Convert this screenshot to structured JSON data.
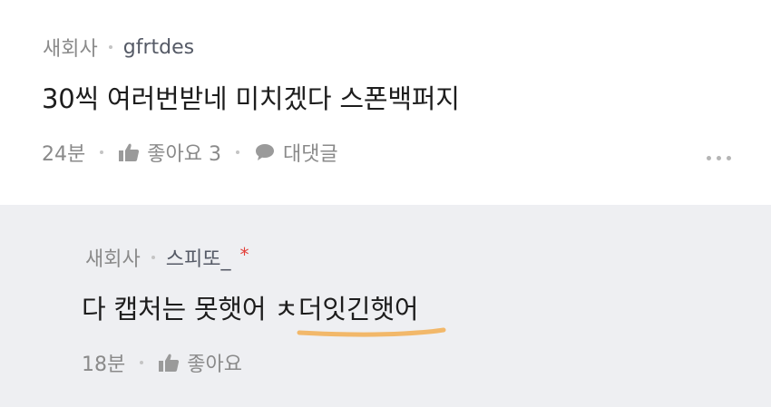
{
  "comment": {
    "company": "새회사",
    "nickname": "gfrtdes",
    "text": "30씩 여러번받네 미치겠다 스폰백퍼지",
    "time": "24분",
    "like_label": "좋아요 3",
    "reply_label": "대댓글"
  },
  "reply": {
    "company": "새회사",
    "nickname": "스피또_",
    "author_mark": "*",
    "text": "다 캡처는 못햇어 ㅊ더잇긴햇어",
    "time": "18분",
    "like_label": "좋아요"
  },
  "icons": {
    "like": "thumbs-up-icon",
    "reply": "speech-bubble-icon",
    "more": "more-dots-icon"
  },
  "colors": {
    "reply_background": "#eeeff2",
    "author_mark": "#e2403a",
    "highlight_underline": "#f2b86a"
  }
}
